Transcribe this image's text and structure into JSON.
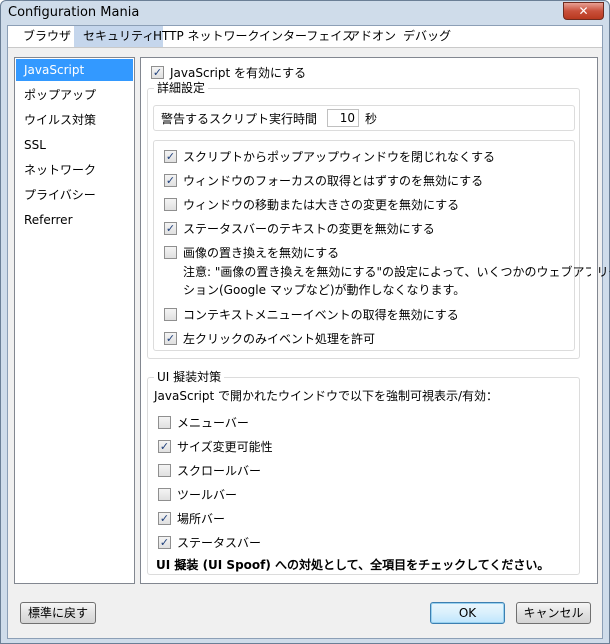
{
  "window": {
    "title": "Configuration Mania",
    "close_glyph": "✕"
  },
  "tabs": [
    {
      "label": "ブラウザ"
    },
    {
      "label": "セキュリティ"
    },
    {
      "label": "HTTP ネットワーク"
    },
    {
      "label": "インターフェイス"
    },
    {
      "label": "アドオン"
    },
    {
      "label": "デバッグ"
    }
  ],
  "sidebar": {
    "items": [
      {
        "label": "JavaScript"
      },
      {
        "label": "ポップアップ"
      },
      {
        "label": "ウイルス対策"
      },
      {
        "label": "SSL"
      },
      {
        "label": "ネットワーク"
      },
      {
        "label": "プライバシー"
      },
      {
        "label": "Referrer"
      }
    ]
  },
  "js": {
    "enable_label": "JavaScript を有効にする",
    "enable_checked": true,
    "details_label": "詳細設定",
    "warn_label": "警告するスクリプト実行時間",
    "warn_value": "10",
    "warn_unit": "秒",
    "options": [
      {
        "label": "スクリプトからポップアップウィンドウを閉じれなくする",
        "checked": true
      },
      {
        "label": "ウィンドウのフォーカスの取得とはずすのを無効にする",
        "checked": true
      },
      {
        "label": "ウィンドウの移動または大きさの変更を無効にする",
        "checked": false
      },
      {
        "label": "ステータスバーのテキストの変更を無効にする",
        "checked": true
      },
      {
        "label": "画像の置き換えを無効にする",
        "checked": false
      }
    ],
    "note_line1": "注意: \"画像の置き換えを無効にする\"の設定によって、いくつかのウェブアプリケー",
    "note_line2": "ション(Google マップなど)が動作しなくなります。",
    "options2": [
      {
        "label": "コンテキストメニューイベントの取得を無効にする",
        "checked": false
      },
      {
        "label": "左クリックのみイベント処理を許可",
        "checked": true
      }
    ]
  },
  "spoof": {
    "group_label": "UI 擬装対策",
    "intro": "JavaScript で開かれたウインドウで以下を強制可視表示/有効：",
    "items": [
      {
        "label": "メニューバー",
        "checked": false
      },
      {
        "label": "サイズ変更可能性",
        "checked": true
      },
      {
        "label": "スクロールバー",
        "checked": false
      },
      {
        "label": "ツールバー",
        "checked": false
      },
      {
        "label": "場所バー",
        "checked": true
      },
      {
        "label": "ステータスバー",
        "checked": true
      }
    ],
    "advice": "UI 擬装 (UI Spoof) への対処として、全項目をチェックしてください。"
  },
  "buttons": {
    "reset": "標準に戻す",
    "ok": "OK",
    "cancel": "キャンセル"
  }
}
